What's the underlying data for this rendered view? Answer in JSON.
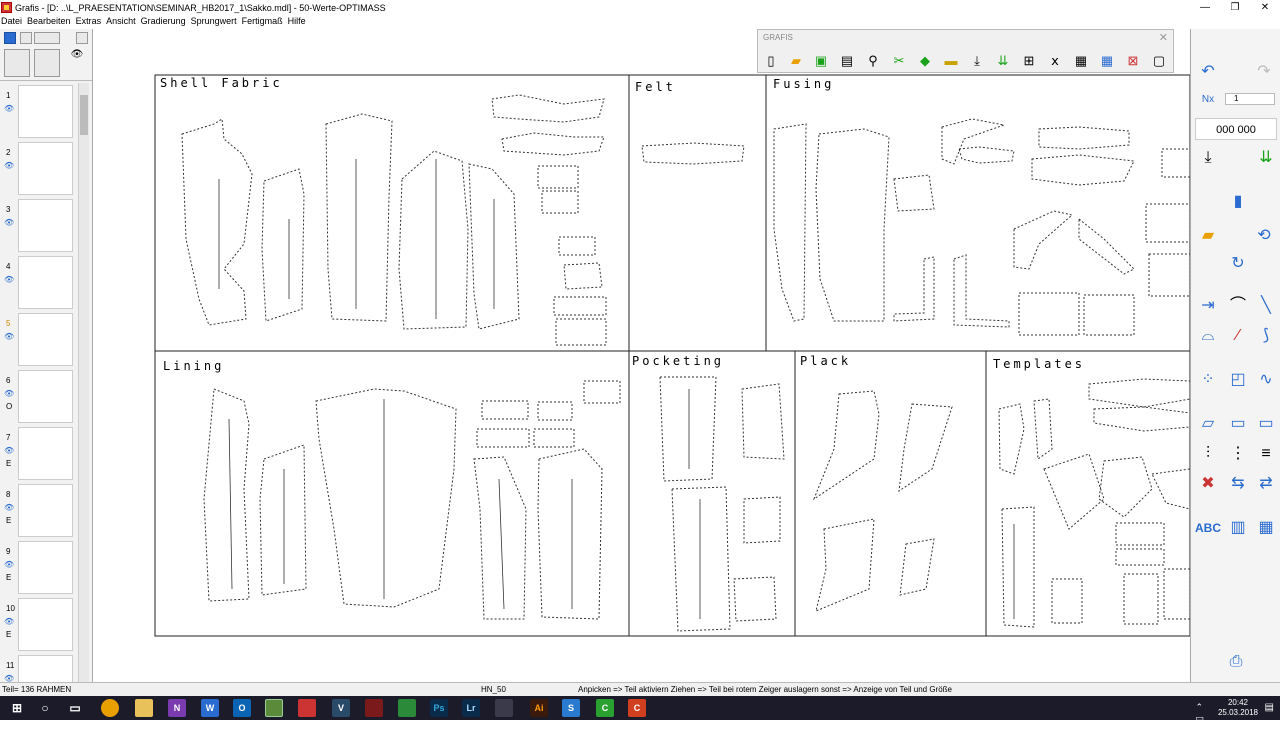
{
  "window": {
    "title": "Grafis - [D: ..\\L_PRAESENTATION\\SEMINAR_HB2017_1\\Sakko.mdl] - 50-Werte-OPTIMASS",
    "minimize": "—",
    "restore": "❐",
    "close": "✕"
  },
  "menu": [
    "Datei",
    "Bearbeiten",
    "Extras",
    "Ansicht",
    "Gradierung",
    "Sprungwert",
    "Fertigmaß",
    "Hilfe"
  ],
  "thumbnails": [
    {
      "num": "1",
      "letter": ""
    },
    {
      "num": "2",
      "letter": ""
    },
    {
      "num": "3",
      "letter": ""
    },
    {
      "num": "4",
      "letter": ""
    },
    {
      "num": "5",
      "letter": ""
    },
    {
      "num": "6",
      "letter": "O"
    },
    {
      "num": "7",
      "letter": "E"
    },
    {
      "num": "8",
      "letter": "E"
    },
    {
      "num": "9",
      "letter": "E"
    },
    {
      "num": "10",
      "letter": "E"
    },
    {
      "num": "11",
      "letter": ""
    }
  ],
  "sections": {
    "shell": "Shell Fabric",
    "felt": "Felt",
    "fusing": "Fusing",
    "lining": "Lining",
    "pocketing": "Pocketing",
    "plack": "Plack",
    "templates": "Templates"
  },
  "toolbar": {
    "title": "GRAFIS",
    "close": "✕"
  },
  "right_panel": {
    "value": "000 000",
    "nx": "Nx",
    "field": "1"
  },
  "status": {
    "parts": "Teil= 136  RAHMEN",
    "hn": "HN_50",
    "hint": "Anpicken => Teil aktiviern Ziehen => Teil bei rotem Zeiger auslagern sonst => Anzeige von Teil und Größe"
  },
  "taskbar": {
    "time": "20:42",
    "date": "25.03.2018"
  },
  "colors": {
    "accent": "#2a6bd0",
    "green": "#1aa31a",
    "taskbar": "#1b1b2a"
  }
}
